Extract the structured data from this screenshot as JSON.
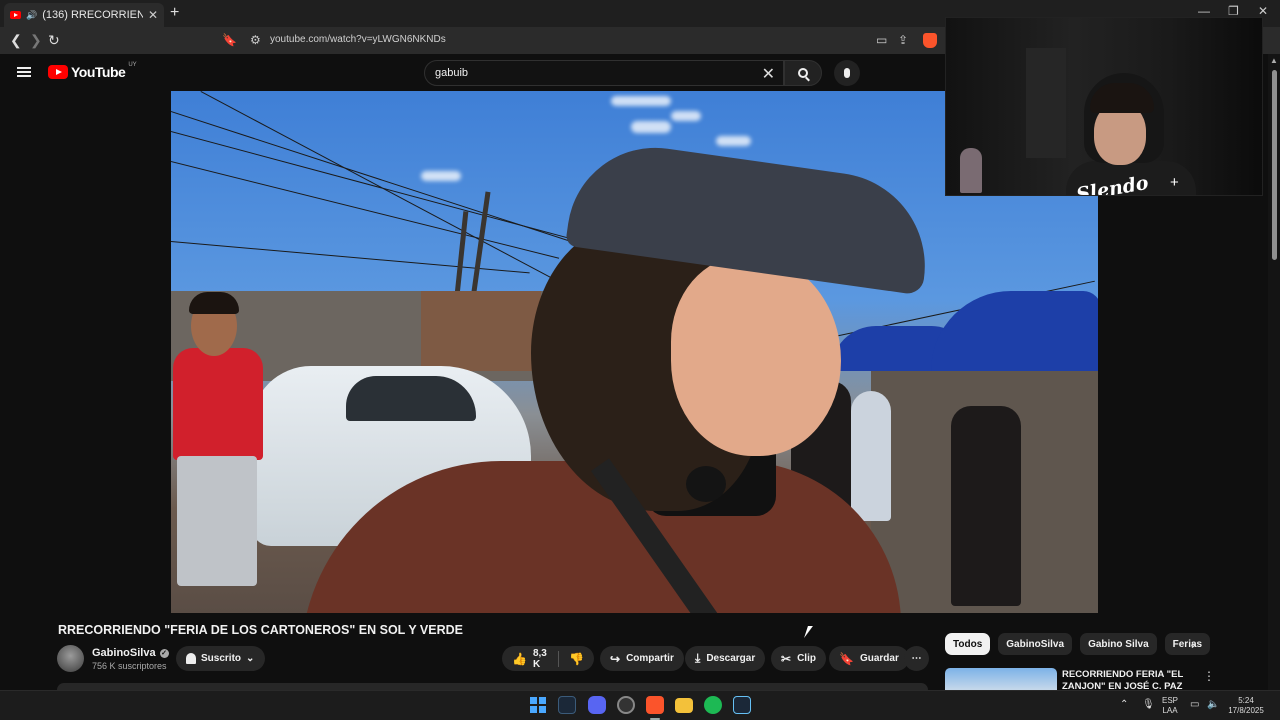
{
  "browser": {
    "tab_title": "(136) RRECORRIENDO \"FERIA DE LOS CARTONEROS\"",
    "tab_close": "✕",
    "new_tab": "+",
    "url": "youtube.com/watch?v=yLWGN6NKNDs",
    "window_controls": [
      "—",
      "❐",
      "✕"
    ]
  },
  "youtube": {
    "logo_text": "YouTube",
    "country_code": "UY",
    "search_value": "gabuib",
    "search_clear": "✕"
  },
  "webcam": {
    "signature": "Slendo",
    "plus": "+"
  },
  "video": {
    "title": "RRECORRIENDO \"FERIA DE LOS CARTONEROS\" EN SOL Y VERDE"
  },
  "channel": {
    "name": "GabinoSilva",
    "verified": "✓",
    "subscribers": "756 K suscriptores",
    "subscribe_label": "Suscrito",
    "chevron": "⌄"
  },
  "actions": {
    "likes": "8,3 K",
    "share": "Compartir",
    "download": "Descargar",
    "clip": "Clip",
    "save": "Guardar",
    "more": "⋯"
  },
  "chips": [
    "Todos",
    "GabinoSilva",
    "Gabino Silva",
    "Ferias"
  ],
  "recommended": {
    "title": "RECORRIENDO FERIA \"EL ZANJON\" EN JOSÉ C. PAZ",
    "more": "⋮"
  },
  "taskbar": {
    "language": "ESP",
    "layout": "LAA",
    "time": "5:24",
    "date": "17/8/2025"
  },
  "colors": {
    "yt_red": "#ff0000",
    "background": "#0f0f0f",
    "pill": "#272727",
    "windows_blue": "#4aa8ff"
  }
}
